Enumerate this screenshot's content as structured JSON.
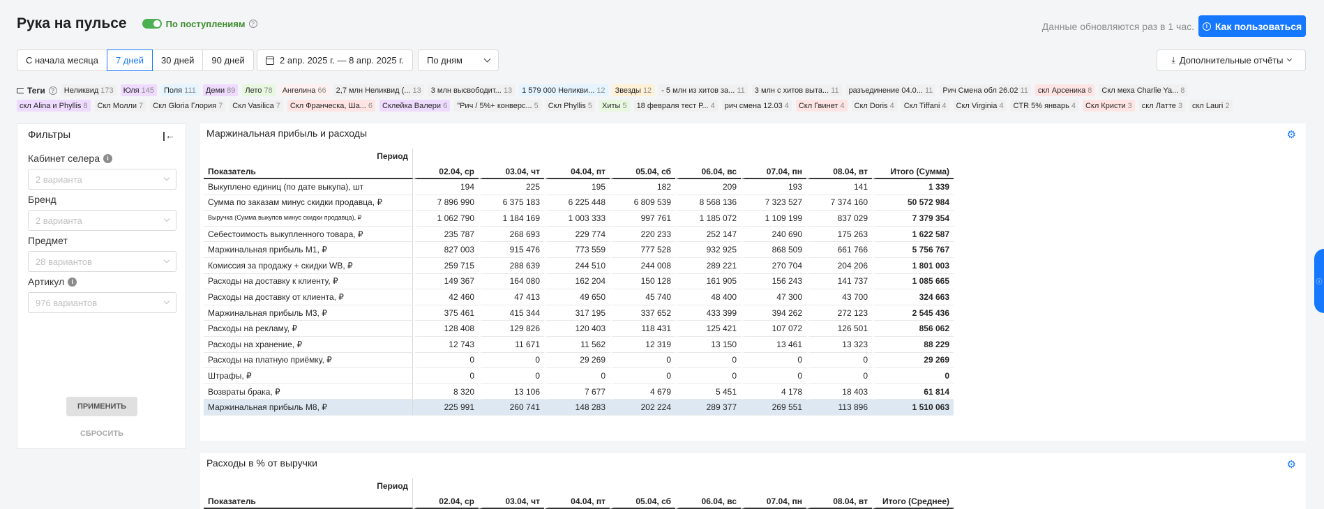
{
  "header": {
    "title": "Рука на пульсе",
    "toggle_label": "По поступлениям",
    "update_note": "Данные обновляются раз в 1 час.",
    "howto_label": "Как пользоваться"
  },
  "periods": [
    {
      "label": "С начала месяца",
      "active": false
    },
    {
      "label": "7 дней",
      "active": true
    },
    {
      "label": "30 дней",
      "active": false
    },
    {
      "label": "90 дней",
      "active": false
    }
  ],
  "date_range": "2 апр. 2025 г. — 8 апр. 2025 г.",
  "grouping": "По дням",
  "reports_label": "Дополнительные отчёты",
  "tags_label": "Теги",
  "tags": [
    {
      "label": "Неликвид",
      "count": "173",
      "color": "#f0f0f0"
    },
    {
      "label": "Юля",
      "count": "145",
      "color": "#efdbff"
    },
    {
      "label": "Поля",
      "count": "111",
      "color": "#e6f4ff"
    },
    {
      "label": "Деми",
      "count": "89",
      "color": "#efdbff"
    },
    {
      "label": "Лето",
      "count": "78",
      "color": "#e8f7df"
    },
    {
      "label": "Ангелина",
      "count": "66",
      "color": "#fff1f0"
    },
    {
      "label": "2,7 млн Неликвид (...",
      "count": "13",
      "color": "#f0f0f0"
    },
    {
      "label": "3 млн высвободит...",
      "count": "13",
      "color": "#f0f0f0"
    },
    {
      "label": "1 579 000 Неликви...",
      "count": "12",
      "color": "#e6f4ff"
    },
    {
      "label": "Звезды",
      "count": "12",
      "color": "#fff1d6"
    },
    {
      "label": "- 5 млн из хитов за...",
      "count": "11",
      "color": "#f0f0f0"
    },
    {
      "label": "3 млн с хитов выта...",
      "count": "11",
      "color": "#f0f0f0"
    },
    {
      "label": "разъединение 04.0...",
      "count": "11",
      "color": "#f0f0f0"
    },
    {
      "label": "Рич Смена обл 26.02",
      "count": "11",
      "color": "#f0f0f0"
    },
    {
      "label": "скл Арсеника",
      "count": "8",
      "color": "#ffe4e4"
    },
    {
      "label": "Скл меха Charlie Ya...",
      "count": "8",
      "color": "#f0f0f0"
    },
    {
      "label": "скл Alina и Phyllis",
      "count": "8",
      "color": "#efdbff"
    },
    {
      "label": "Скл Молли",
      "count": "7",
      "color": "#f0f0f0"
    },
    {
      "label": "Скл Gloria Глория",
      "count": "7",
      "color": "#f0f0f0"
    },
    {
      "label": "Скл Vasilica",
      "count": "7",
      "color": "#f0f0f0"
    },
    {
      "label": "Скл Франческа, Ша...",
      "count": "6",
      "color": "#ffe4e4"
    },
    {
      "label": "Склейка Валери",
      "count": "6",
      "color": "#efdbff"
    },
    {
      "label": "\"Рич / 5%+ конверс...",
      "count": "5",
      "color": "#f0f0f0"
    },
    {
      "label": "Скл Phyllis",
      "count": "5",
      "color": "#f0f0f0"
    },
    {
      "label": "Хиты",
      "count": "5",
      "color": "#e8f7df"
    },
    {
      "label": "18 февраля тест Р...",
      "count": "4",
      "color": "#f0f0f0"
    },
    {
      "label": "рич смена 12.03",
      "count": "4",
      "color": "#f0f0f0"
    },
    {
      "label": "Скл Гвинет",
      "count": "4",
      "color": "#ffe4e4"
    },
    {
      "label": "Скл Doris",
      "count": "4",
      "color": "#f0f0f0"
    },
    {
      "label": "Скл Tiffani",
      "count": "4",
      "color": "#f0f0f0"
    },
    {
      "label": "Скл Virginia",
      "count": "4",
      "color": "#f0f0f0"
    },
    {
      "label": "CTR 5% январь",
      "count": "4",
      "color": "#f0f0f0"
    },
    {
      "label": "Скл Кристи",
      "count": "3",
      "color": "#ffe4e4"
    },
    {
      "label": "скл Латте",
      "count": "3",
      "color": "#f0f0f0"
    },
    {
      "label": "скл Lauri",
      "count": "2",
      "color": "#f0f0f0"
    }
  ],
  "filters": {
    "title": "Фильтры",
    "fields": [
      {
        "label": "Кабинет селера",
        "info": true,
        "placeholder": "2 варианта"
      },
      {
        "label": "Бренд",
        "info": false,
        "placeholder": "2 варианта"
      },
      {
        "label": "Предмет",
        "info": false,
        "placeholder": "28 вариантов"
      },
      {
        "label": "Артикул",
        "info": true,
        "placeholder": "976 вариантов"
      }
    ],
    "apply_label": "ПРИМЕНИТЬ",
    "reset_label": "СБРОСИТЬ"
  },
  "table1": {
    "title": "Маржинальная прибыль и расходы",
    "period_label": "Период",
    "indicator_label": "Показатель",
    "columns": [
      "02.04, ср",
      "03.04, чт",
      "04.04, пт",
      "05.04, сб",
      "06.04, вс",
      "07.04, пн",
      "08.04, вт"
    ],
    "total_label": "Итого (Сумма)",
    "rows": [
      {
        "name": "Выкуплено единиц (по дате выкупа), шт",
        "values": [
          "194",
          "225",
          "195",
          "182",
          "209",
          "193",
          "141"
        ],
        "total": "1 339"
      },
      {
        "name": "Сумма по заказам минус скидки продавца, ₽",
        "values": [
          "7 896 990",
          "6 375 183",
          "6 225 448",
          "6 809 539",
          "8 568 136",
          "7 323 527",
          "7 374 160"
        ],
        "total": "50 572 984"
      },
      {
        "name": "Выручка (Сумма выкупов минус скидки продавца), ₽",
        "small": true,
        "values": [
          "1 062 790",
          "1 184 169",
          "1 003 333",
          "997 761",
          "1 185 072",
          "1 109 199",
          "837 029"
        ],
        "total": "7 379 354"
      },
      {
        "name": "Себестоимость выкупленного товара, ₽",
        "values": [
          "235 787",
          "268 693",
          "229 774",
          "220 233",
          "252 147",
          "240 690",
          "175 263"
        ],
        "total": "1 622 587"
      },
      {
        "name": "Маржинальная прибыль М1, ₽",
        "values": [
          "827 003",
          "915 476",
          "773 559",
          "777 528",
          "932 925",
          "868 509",
          "661 766"
        ],
        "total": "5 756 767"
      },
      {
        "name": "Комиссия за продажу + скидки WB, ₽",
        "values": [
          "259 715",
          "288 639",
          "244 510",
          "244 008",
          "289 221",
          "270 704",
          "204 206"
        ],
        "total": "1 801 003"
      },
      {
        "name": "Расходы на доставку к клиенту, ₽",
        "values": [
          "149 367",
          "164 080",
          "162 204",
          "150 128",
          "161 905",
          "156 243",
          "141 737"
        ],
        "total": "1 085 665"
      },
      {
        "name": "Расходы на доставку от клиента, ₽",
        "values": [
          "42 460",
          "47 413",
          "49 650",
          "45 740",
          "48 400",
          "47 300",
          "43 700"
        ],
        "total": "324 663"
      },
      {
        "name": "Маржинальная прибыль М3, ₽",
        "values": [
          "375 461",
          "415 344",
          "317 195",
          "337 652",
          "433 399",
          "394 262",
          "272 123"
        ],
        "total": "2 545 436"
      },
      {
        "name": "Расходы на рекламу, ₽",
        "values": [
          "128 408",
          "129 826",
          "120 403",
          "118 431",
          "125 421",
          "107 072",
          "126 501"
        ],
        "total": "856 062"
      },
      {
        "name": "Расходы на хранение, ₽",
        "values": [
          "12 743",
          "11 671",
          "11 562",
          "12 319",
          "13 150",
          "13 461",
          "13 323"
        ],
        "total": "88 229"
      },
      {
        "name": "Расходы на платную приёмку, ₽",
        "values": [
          "0",
          "0",
          "29 269",
          "0",
          "0",
          "0",
          "0"
        ],
        "total": "29 269"
      },
      {
        "name": "Штрафы, ₽",
        "values": [
          "0",
          "0",
          "0",
          "0",
          "0",
          "0",
          "0"
        ],
        "total": "0"
      },
      {
        "name": "Возвраты брака, ₽",
        "values": [
          "8 320",
          "13 106",
          "7 677",
          "4 679",
          "5 451",
          "4 178",
          "18 403"
        ],
        "total": "61 814"
      },
      {
        "name": "Маржинальная прибыль М8, ₽",
        "highlight": true,
        "values": [
          "225 991",
          "260 741",
          "148 283",
          "202 224",
          "289 377",
          "269 551",
          "113 896"
        ],
        "total": "1 510 063"
      }
    ]
  },
  "table2": {
    "title": "Расходы в % от выручки",
    "period_label": "Период",
    "indicator_label": "Показатель",
    "columns": [
      "02.04, ср",
      "03.04, чт",
      "04.04, пт",
      "05.04, сб",
      "06.04, вс",
      "07.04, пн",
      "08.04, вт"
    ],
    "total_label": "Итого (Среднее)"
  }
}
